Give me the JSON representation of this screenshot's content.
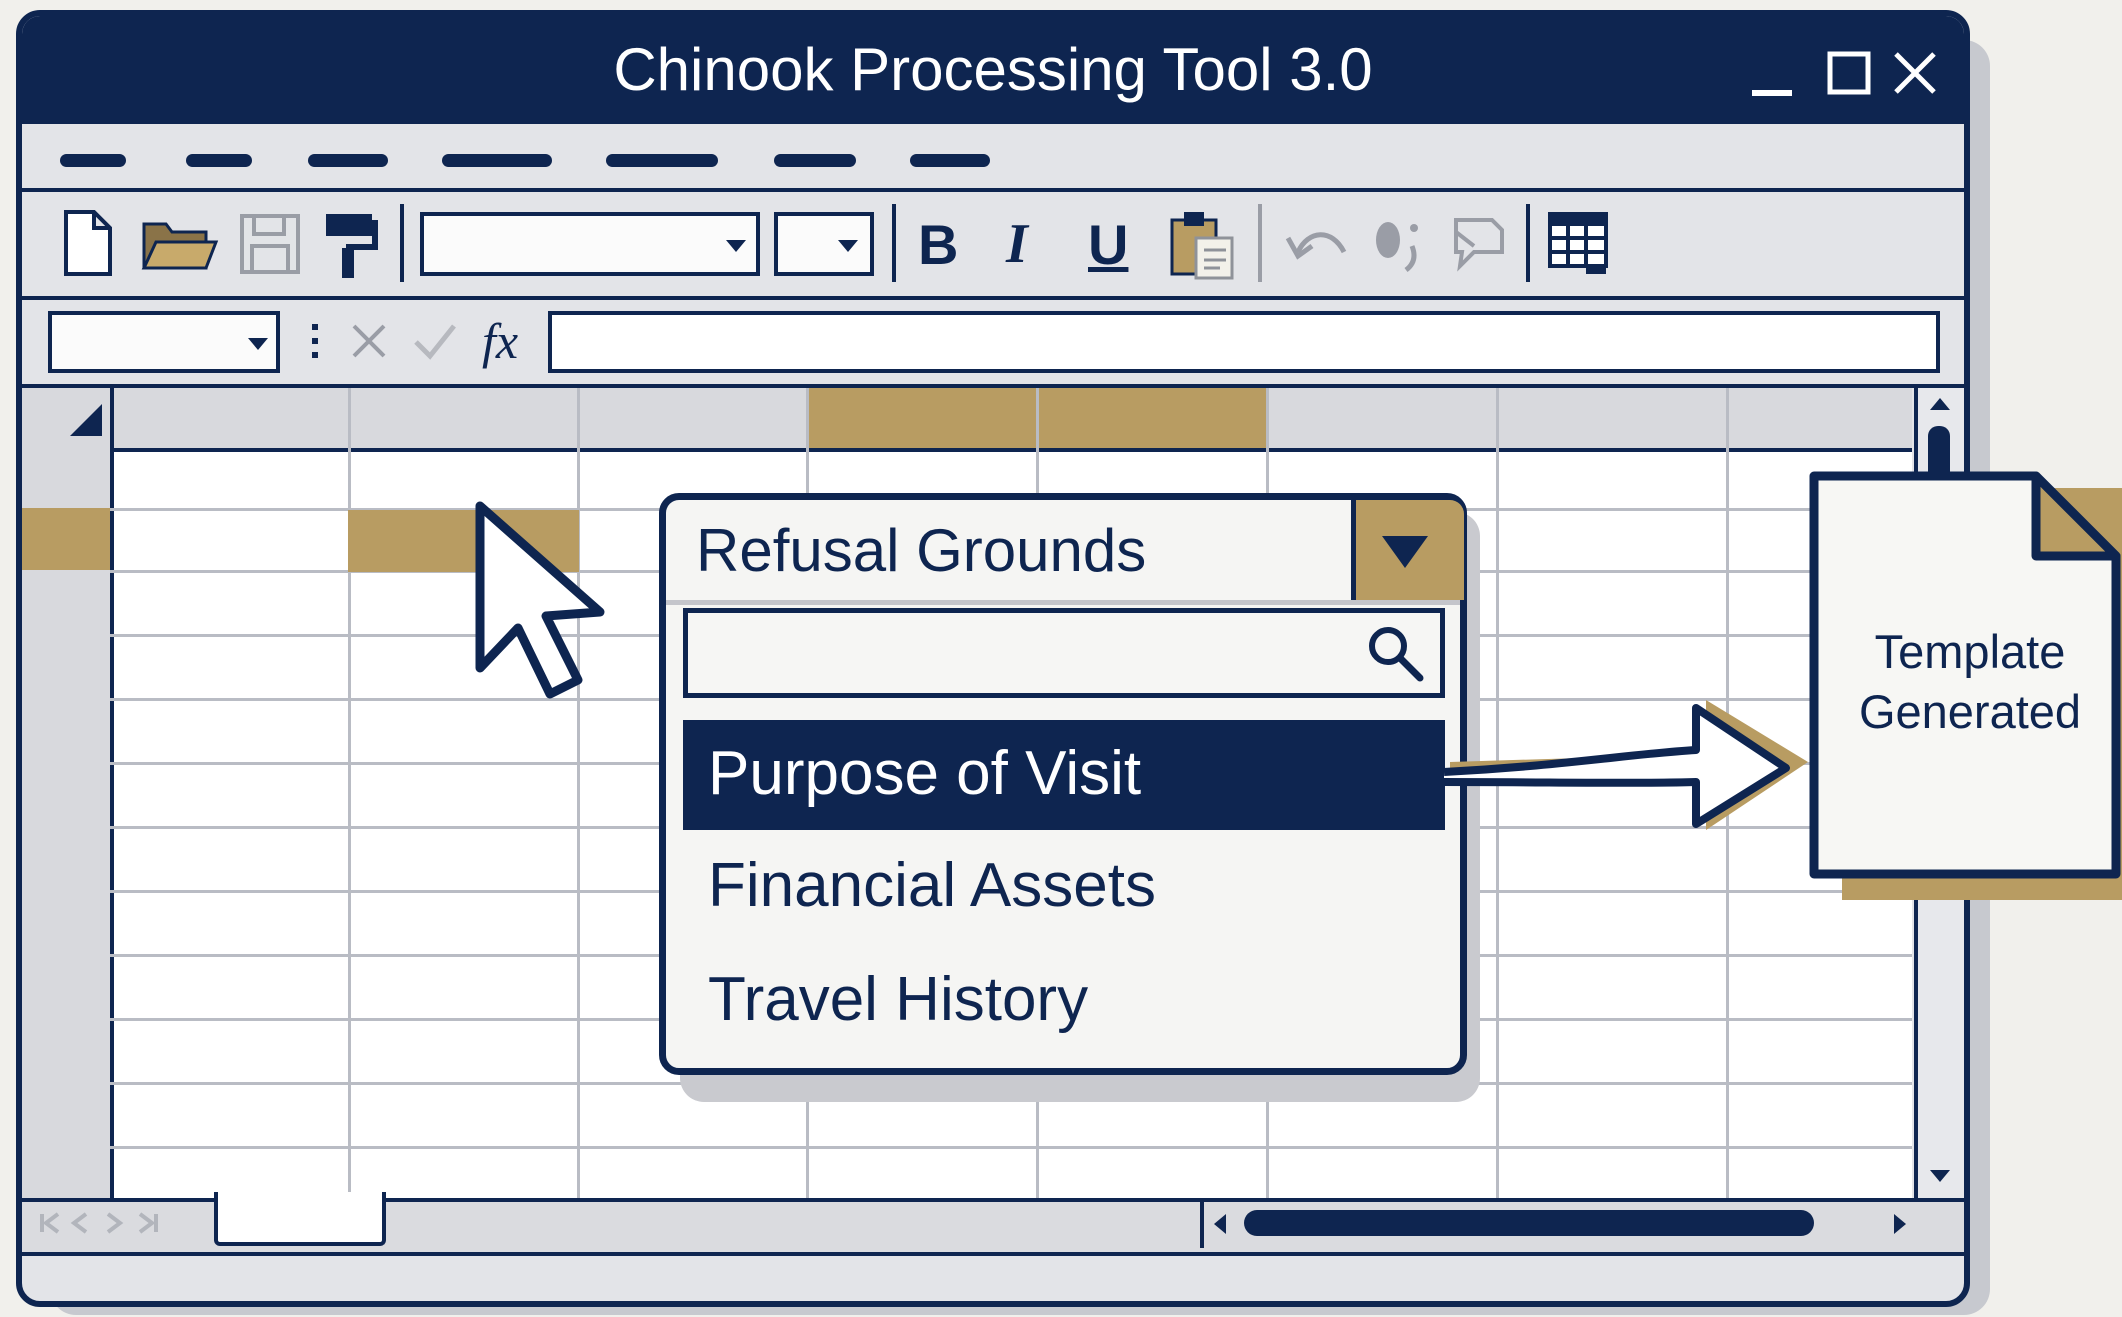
{
  "window": {
    "title": "Chinook Processing Tool 3.0",
    "controls": [
      "minimize-icon",
      "maximize-icon",
      "close-icon"
    ]
  },
  "toolbar": {
    "icons": [
      "new-document-icon",
      "open-folder-icon",
      "save-icon",
      "format-painter-icon",
      "bold-icon",
      "italic-icon",
      "underline-icon",
      "paste-icon",
      "undo-icon",
      "redo-icon",
      "comment-icon",
      "table-icon"
    ],
    "bold_label": "B",
    "italic_label": "I",
    "underline_label": "U"
  },
  "formula_bar": {
    "fx_label": "fx",
    "value": ""
  },
  "dropdown": {
    "header": "Refusal Grounds",
    "search_value": "",
    "options": [
      {
        "label": "Purpose of Visit",
        "selected": true
      },
      {
        "label": "Financial Assets",
        "selected": false
      },
      {
        "label": "Travel History",
        "selected": false
      }
    ]
  },
  "output_document": {
    "label_line1": "Template",
    "label_line2": "Generated"
  },
  "colors": {
    "navy": "#0e2550",
    "gold": "#b89c62",
    "chrome": "#e3e4e8"
  }
}
